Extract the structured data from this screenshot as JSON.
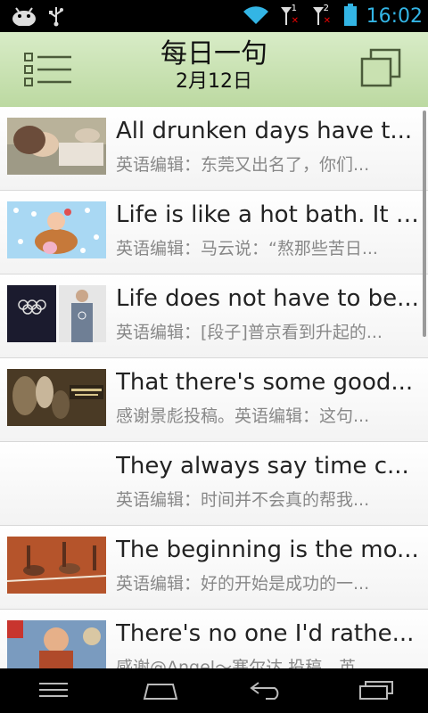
{
  "status_bar": {
    "time": "16:02",
    "sim1": "1",
    "sim2": "2",
    "icons": [
      "android-icon",
      "usb-icon",
      "wifi-icon",
      "signal-1-icon",
      "signal-2-icon",
      "battery-icon"
    ]
  },
  "header": {
    "title": "每日一句",
    "date": "2月12日",
    "background": "#c8e2b0"
  },
  "list": {
    "items": [
      {
        "title": "All drunken days have t...",
        "subtitle": "英语编辑：东莞又出名了，你们...",
        "thumb": "woman-lying-photo"
      },
      {
        "title": "Life is like a hot bath. It f...",
        "subtitle": "英语编辑：马云说：“熬那些苦日...",
        "thumb": "cartoon-bath-photo"
      },
      {
        "title": "Life does not have to be...",
        "subtitle": "英语编辑：[段子]普京看到升起的...",
        "thumb": "olympic-rings-photo"
      },
      {
        "title": "That there's some good...",
        "subtitle": "感谢景彪投稿。英语编辑：这句...",
        "thumb": "lord-of-the-rings-photo"
      },
      {
        "title": "They always say time c...",
        "subtitle": "英语编辑：时间并不会真的帮我...",
        "thumb": ""
      },
      {
        "title": "The beginning is the mo...",
        "subtitle": "英语编辑：好的开始是成功的一...",
        "thumb": "runners-start-photo"
      },
      {
        "title": "There's no one I'd rathe...",
        "subtitle": "感谢@Angel～寒尔达 投稿。英...",
        "thumb": "wreck-it-ralph-photo"
      }
    ]
  },
  "nav_bar": {
    "buttons": [
      "menu-icon",
      "home-icon",
      "back-icon",
      "recents-icon"
    ]
  }
}
